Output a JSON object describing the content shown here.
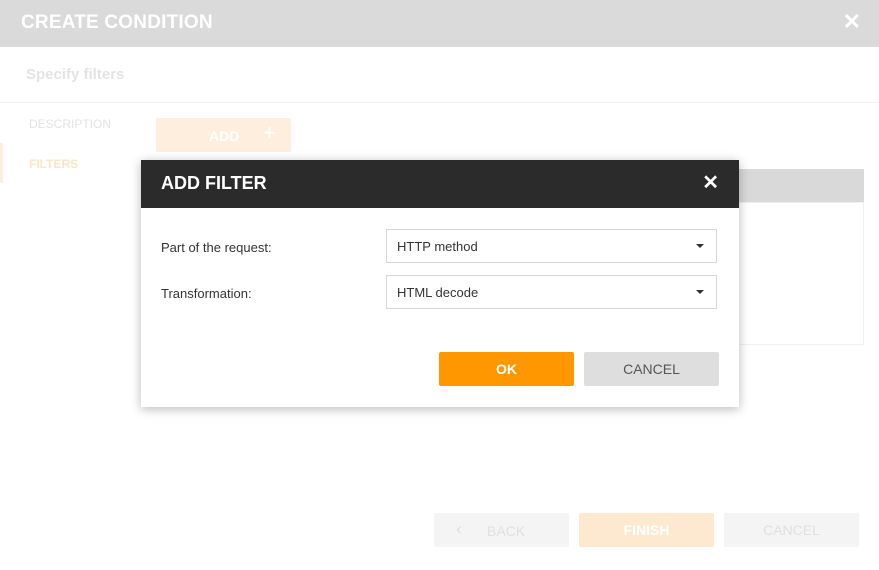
{
  "wizard": {
    "title": "CREATE CONDITION",
    "subtitle": "Specify filters",
    "steps": [
      {
        "label": "DESCRIPTION"
      },
      {
        "label": "FILTERS"
      }
    ],
    "add_label": "ADD",
    "add_icon": "plus-icon",
    "close_icon": "close-icon",
    "footer": {
      "back_label": "BACK",
      "finish_label": "FINISH",
      "cancel_label": "CANCEL"
    }
  },
  "modal": {
    "title": "ADD FILTER",
    "close_icon": "close-icon",
    "fields": [
      {
        "label": "Part of the request:",
        "value": "HTTP method"
      },
      {
        "label": "Transformation:",
        "value": "HTML decode"
      }
    ],
    "ok_label": "OK",
    "cancel_label": "CANCEL"
  },
  "colors": {
    "accent": "#ff9800",
    "modal_header": "#2b2b2b",
    "wizard_header": "#dadada"
  }
}
